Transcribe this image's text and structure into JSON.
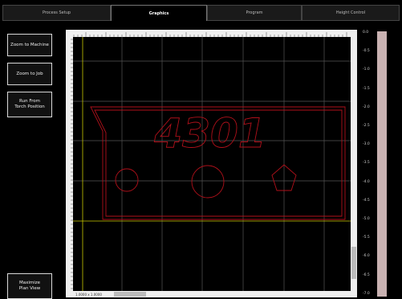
{
  "tabs": [
    {
      "label": "Process Setup",
      "active": false
    },
    {
      "label": "Graphics",
      "active": true
    },
    {
      "label": "Program",
      "active": false
    },
    {
      "label": "Height Control",
      "active": false
    }
  ],
  "left_panel": {
    "zoom_machine": "Zoom to Machine",
    "zoom_job": "Zoom to Job",
    "run_from_torch": "Run From\nTorch Position",
    "maximize_plan": "Maximize\nPlan View"
  },
  "plot": {
    "status_readout": "1.0000 x 1.0000",
    "part_text": "4301"
  },
  "z_scale": {
    "labels": [
      "0.0",
      "-0.5",
      "-1.0",
      "-1.5",
      "-2.0",
      "-2.5",
      "-3.0",
      "-3.5",
      "-4.0",
      "-4.5",
      "-5.0",
      "-5.5",
      "-6.0",
      "-6.5",
      "-7.0"
    ]
  },
  "colors": {
    "background": "#000000",
    "grid": "#555555",
    "guide": "#c8c800",
    "part": "#b0101a",
    "ruler": "#e8e8e8",
    "bar": "#c9b2b2"
  }
}
